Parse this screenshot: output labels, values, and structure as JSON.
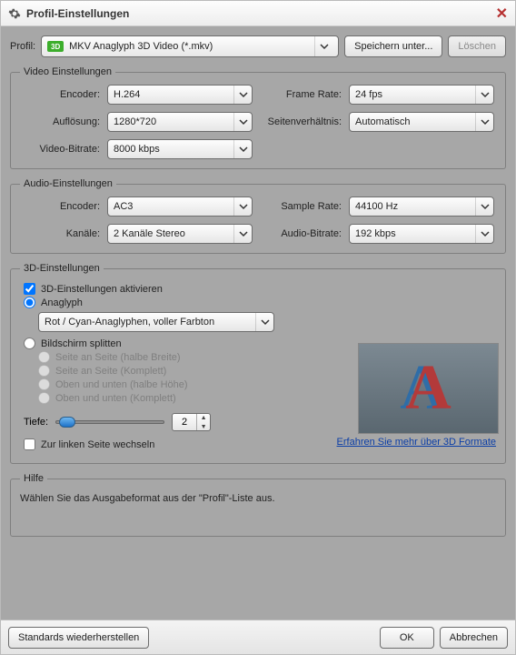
{
  "window": {
    "title": "Profil-Einstellungen"
  },
  "profile": {
    "label": "Profil:",
    "badge": "3D",
    "value": "MKV Anaglyph 3D Video (*.mkv)",
    "save_label": "Speichern unter...",
    "delete_label": "Löschen"
  },
  "video": {
    "legend": "Video Einstellungen",
    "encoder_label": "Encoder:",
    "encoder_value": "H.264",
    "framerate_label": "Frame Rate:",
    "framerate_value": "24 fps",
    "resolution_label": "Auflösung:",
    "resolution_value": "1280*720",
    "aspect_label": "Seitenverhältnis:",
    "aspect_value": "Automatisch",
    "vbitrate_label": "Video-Bitrate:",
    "vbitrate_value": "8000 kbps"
  },
  "audio": {
    "legend": "Audio-Einstellungen",
    "encoder_label": "Encoder:",
    "encoder_value": "AC3",
    "samplerate_label": "Sample Rate:",
    "samplerate_value": "44100 Hz",
    "channels_label": "Kanäle:",
    "channels_value": "2 Kanäle Stereo",
    "abitrate_label": "Audio-Bitrate:",
    "abitrate_value": "192 kbps"
  },
  "three_d": {
    "legend": "3D-Einstellungen",
    "enable_label": "3D-Einstellungen aktivieren",
    "anaglyph_label": "Anaglyph",
    "anaglyph_mode": "Rot / Cyan-Anaglyphen, voller Farbton",
    "split_label": "Bildschirm splitten",
    "opts": {
      "sbs_half": "Seite an Seite (halbe Breite)",
      "sbs_full": "Seite an Seite (Komplett)",
      "tab_half": "Oben und unten (halbe Höhe)",
      "tab_full": "Oben und unten (Komplett)"
    },
    "depth_label": "Tiefe:",
    "depth_value": "2",
    "swap_label": "Zur linken Seite wechseln",
    "learn_more": "Erfahren Sie mehr über 3D Formate"
  },
  "help": {
    "legend": "Hilfe",
    "text": "Wählen Sie das Ausgabeformat aus der \"Profil\"-Liste aus."
  },
  "footer": {
    "restore": "Standards wiederherstellen",
    "ok": "OK",
    "cancel": "Abbrechen"
  }
}
